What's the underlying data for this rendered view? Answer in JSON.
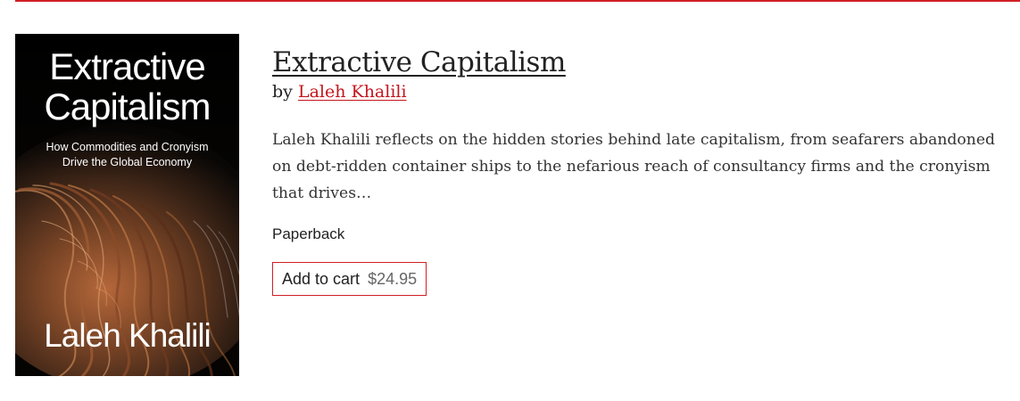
{
  "book": {
    "cover": {
      "title_line1": "Extractive",
      "title_line2": "Capitalism",
      "subtitle_line1": "How Commodities and Cronyism",
      "subtitle_line2": "Drive the Global Economy",
      "author": "Laleh Khalili"
    },
    "title": "Extractive Capitalism",
    "by_prefix": "by",
    "author": "Laleh Khalili",
    "description": "Laleh Khalili reflects on the hidden stories behind late capitalism, from seafarers abandoned on debt-ridden container ships to the nefarious reach of consultancy firms and the cronyism that drives…",
    "format": "Paperback",
    "cart": {
      "label": "Add to cart",
      "price": "$24.95"
    }
  },
  "colors": {
    "accent": "#d11f26",
    "author_link": "#c4151c",
    "text": "#222222",
    "price": "#666666"
  }
}
